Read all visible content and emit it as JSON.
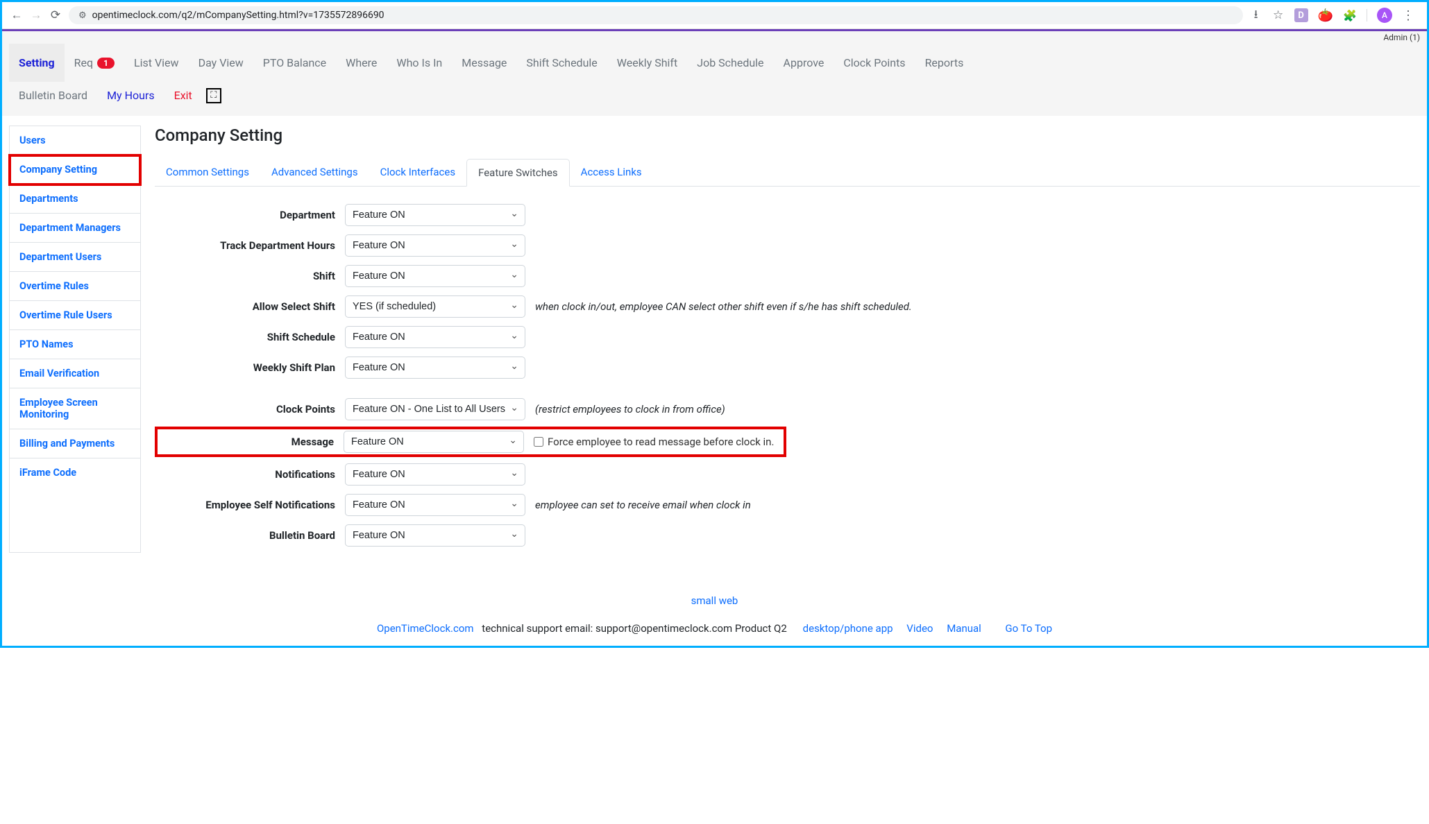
{
  "browser": {
    "url": "opentimeclock.com/q2/mCompanySetting.html?v=1735572896690",
    "avatar_letter": "A",
    "ext_d": "D"
  },
  "admin_label": "Admin (1)",
  "topnav1": {
    "setting": "Setting",
    "req": "Req",
    "req_badge": "1",
    "list_view": "List View",
    "day_view": "Day View",
    "pto_balance": "PTO Balance",
    "where": "Where",
    "who_is_in": "Who Is In",
    "message": "Message",
    "shift_schedule": "Shift Schedule",
    "weekly_shift": "Weekly Shift",
    "job_schedule": "Job Schedule",
    "approve": "Approve",
    "clock_points": "Clock Points",
    "reports": "Reports"
  },
  "topnav2": {
    "bulletin": "Bulletin Board",
    "my_hours": "My Hours",
    "exit": "Exit"
  },
  "sidebar": {
    "items": [
      "Users",
      "Company Setting",
      "Departments",
      "Department Managers",
      "Department Users",
      "Overtime Rules",
      "Overtime Rule Users",
      "PTO Names",
      "Email Verification",
      "Employee Screen Monitoring",
      "Billing and Payments",
      "iFrame Code"
    ]
  },
  "page_title": "Company Setting",
  "tabs": {
    "common": "Common Settings",
    "advanced": "Advanced Settings",
    "clock": "Clock Interfaces",
    "feature": "Feature Switches",
    "access": "Access Links"
  },
  "form": {
    "department": {
      "label": "Department",
      "value": "Feature ON"
    },
    "track_dept": {
      "label": "Track Department Hours",
      "value": "Feature ON"
    },
    "shift": {
      "label": "Shift",
      "value": "Feature ON"
    },
    "allow_select_shift": {
      "label": "Allow Select Shift",
      "value": "YES (if scheduled)",
      "help": "when clock in/out, employee CAN select other shift even if s/he has shift scheduled."
    },
    "shift_schedule": {
      "label": "Shift Schedule",
      "value": "Feature ON"
    },
    "weekly_shift_plan": {
      "label": "Weekly Shift Plan",
      "value": "Feature ON"
    },
    "clock_points": {
      "label": "Clock Points",
      "value": "Feature ON - One List to All Users",
      "help": "(restrict employees to clock in from office)"
    },
    "message": {
      "label": "Message",
      "value": "Feature ON",
      "checkbox_label": "Force employee to read message before clock in."
    },
    "notifications": {
      "label": "Notifications",
      "value": "Feature ON"
    },
    "emp_self_notif": {
      "label": "Employee Self Notifications",
      "value": "Feature ON",
      "help": "employee can set to receive email when clock in"
    },
    "bulletin_board": {
      "label": "Bulletin Board",
      "value": "Feature ON"
    }
  },
  "footer": {
    "small_web": "small web",
    "brand": "OpenTimeClock.com",
    "support_text": " technical support email: support@opentimeclock.com Product Q2",
    "links": {
      "app": "desktop/phone app",
      "video": "Video",
      "manual": "Manual",
      "top": "Go To Top"
    }
  }
}
